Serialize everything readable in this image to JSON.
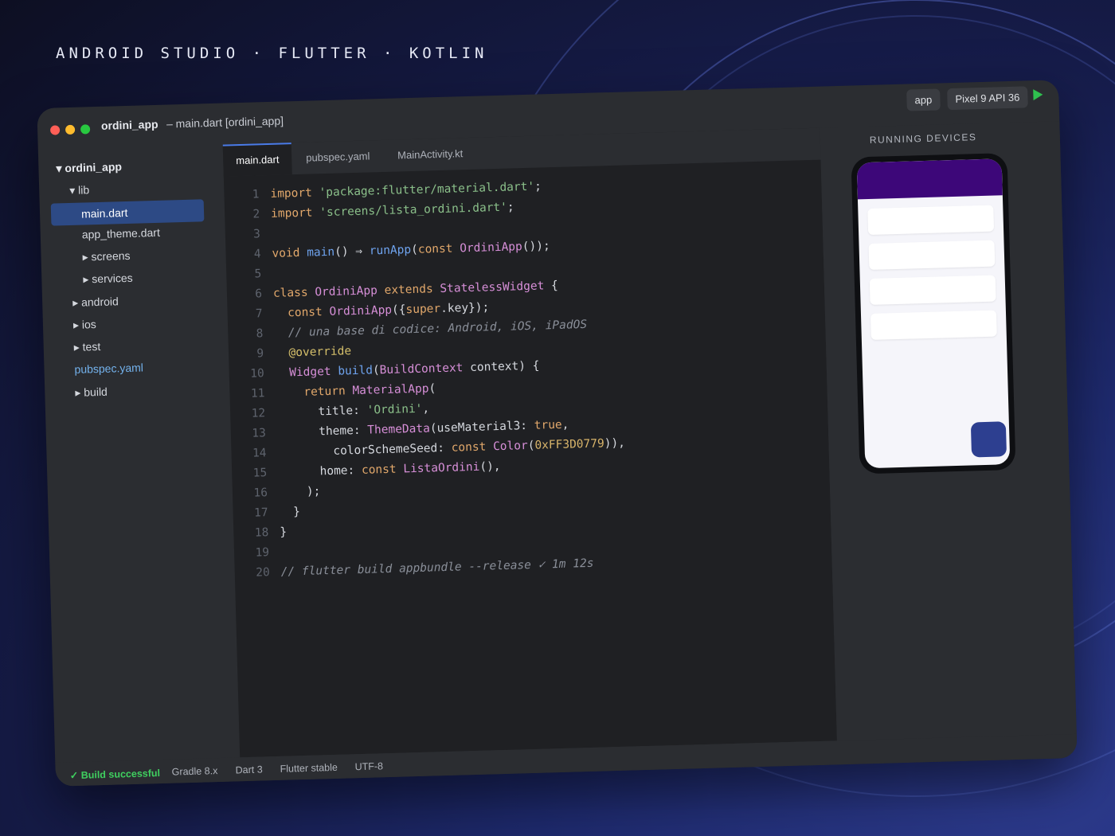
{
  "heading": "ANDROID STUDIO · FLUTTER · KOTLIN",
  "titlebar": {
    "project": "ordini_app",
    "subtitle": "– main.dart [ordini_app]",
    "run_config": "app",
    "device": "Pixel 9 API 36"
  },
  "sidebar": {
    "items": [
      {
        "label": "▾ ordini_app"
      },
      {
        "label": "▾ lib"
      },
      {
        "label": "main.dart"
      },
      {
        "label": "app_theme.dart"
      },
      {
        "label": "▸ screens"
      },
      {
        "label": "▸ services"
      },
      {
        "label": "▸ android"
      },
      {
        "label": "▸ ios"
      },
      {
        "label": "▸ test"
      },
      {
        "label": "pubspec.yaml"
      },
      {
        "label": "▸ build"
      }
    ]
  },
  "tabs": [
    {
      "label": "main.dart"
    },
    {
      "label": "pubspec.yaml"
    },
    {
      "label": "MainActivity.kt"
    }
  ],
  "code": {
    "line_numbers": [
      "1",
      "2",
      "3",
      "4",
      "5",
      "6",
      "7",
      "8",
      "9",
      "10",
      "11",
      "12",
      "13",
      "14",
      "15",
      "16",
      "17",
      "18",
      "19",
      "20"
    ],
    "l1": {
      "kw": "import",
      "str": "'package:flutter/material.dart'",
      "end": ";"
    },
    "l2": {
      "kw": "import",
      "str": "'screens/lista_ordini.dart'",
      "end": ";"
    },
    "l4": {
      "kw": "void",
      "fn": "main",
      "p1": "() ⇒ ",
      "fn2": "runApp",
      "p2": "(",
      "kw2": "const",
      "cls": "OrdiniApp",
      "end": "());"
    },
    "l6": {
      "kw": "class",
      "cls": "OrdiniApp",
      "kw2": "extends",
      "cls2": "StatelessWidget",
      "end": "{"
    },
    "l7": {
      "kw": "const",
      "cls": "OrdiniApp",
      "p1": "({",
      "kw2": "super",
      "end": ".key});"
    },
    "l8": {
      "cmt": "// una base di codice: Android, iOS, iPadOS"
    },
    "l9": {
      "ann": "@override"
    },
    "l10": {
      "cls": "Widget",
      "fn": "build",
      "p1": "(",
      "cls2": "BuildContext",
      "end": " context) {"
    },
    "l11": {
      "kw": "return",
      "cls": "MaterialApp",
      "end": "("
    },
    "l12": {
      "p1": "title: ",
      "str": "'Ordini'",
      "end": ","
    },
    "l13": {
      "p1": "theme: ",
      "cls": "ThemeData",
      "p2": "(useMaterial3: ",
      "kw": "true",
      "end": ","
    },
    "l14": {
      "p1": "colorSchemeSeed: ",
      "kw": "const",
      "cls": "Color",
      "p2": "(",
      "num": "0xFF3D0779",
      "end": ")),"
    },
    "l15": {
      "p1": "home: ",
      "kw": "const",
      "cls": "ListaOrdini",
      "end": "(),"
    },
    "l16": {
      "text": ");"
    },
    "l17": {
      "text": "}"
    },
    "l18": {
      "text": "}"
    },
    "l20": {
      "cmt": "// flutter build appbundle --release ✓ 1m 12s"
    }
  },
  "device_panel": {
    "title": "RUNNING DEVICES",
    "phone_card_count": 4
  },
  "statusbar": {
    "build": "✓ Build successful",
    "gradle": "Gradle 8.x",
    "dart": "Dart 3",
    "flutter": "Flutter stable",
    "encoding": "UTF-8"
  },
  "colors": {
    "accent_blue": "#4a7be8",
    "app_seed_purple": "#3D0779",
    "success_green": "#3fcf5f",
    "run_green": "#2fbf4f"
  }
}
